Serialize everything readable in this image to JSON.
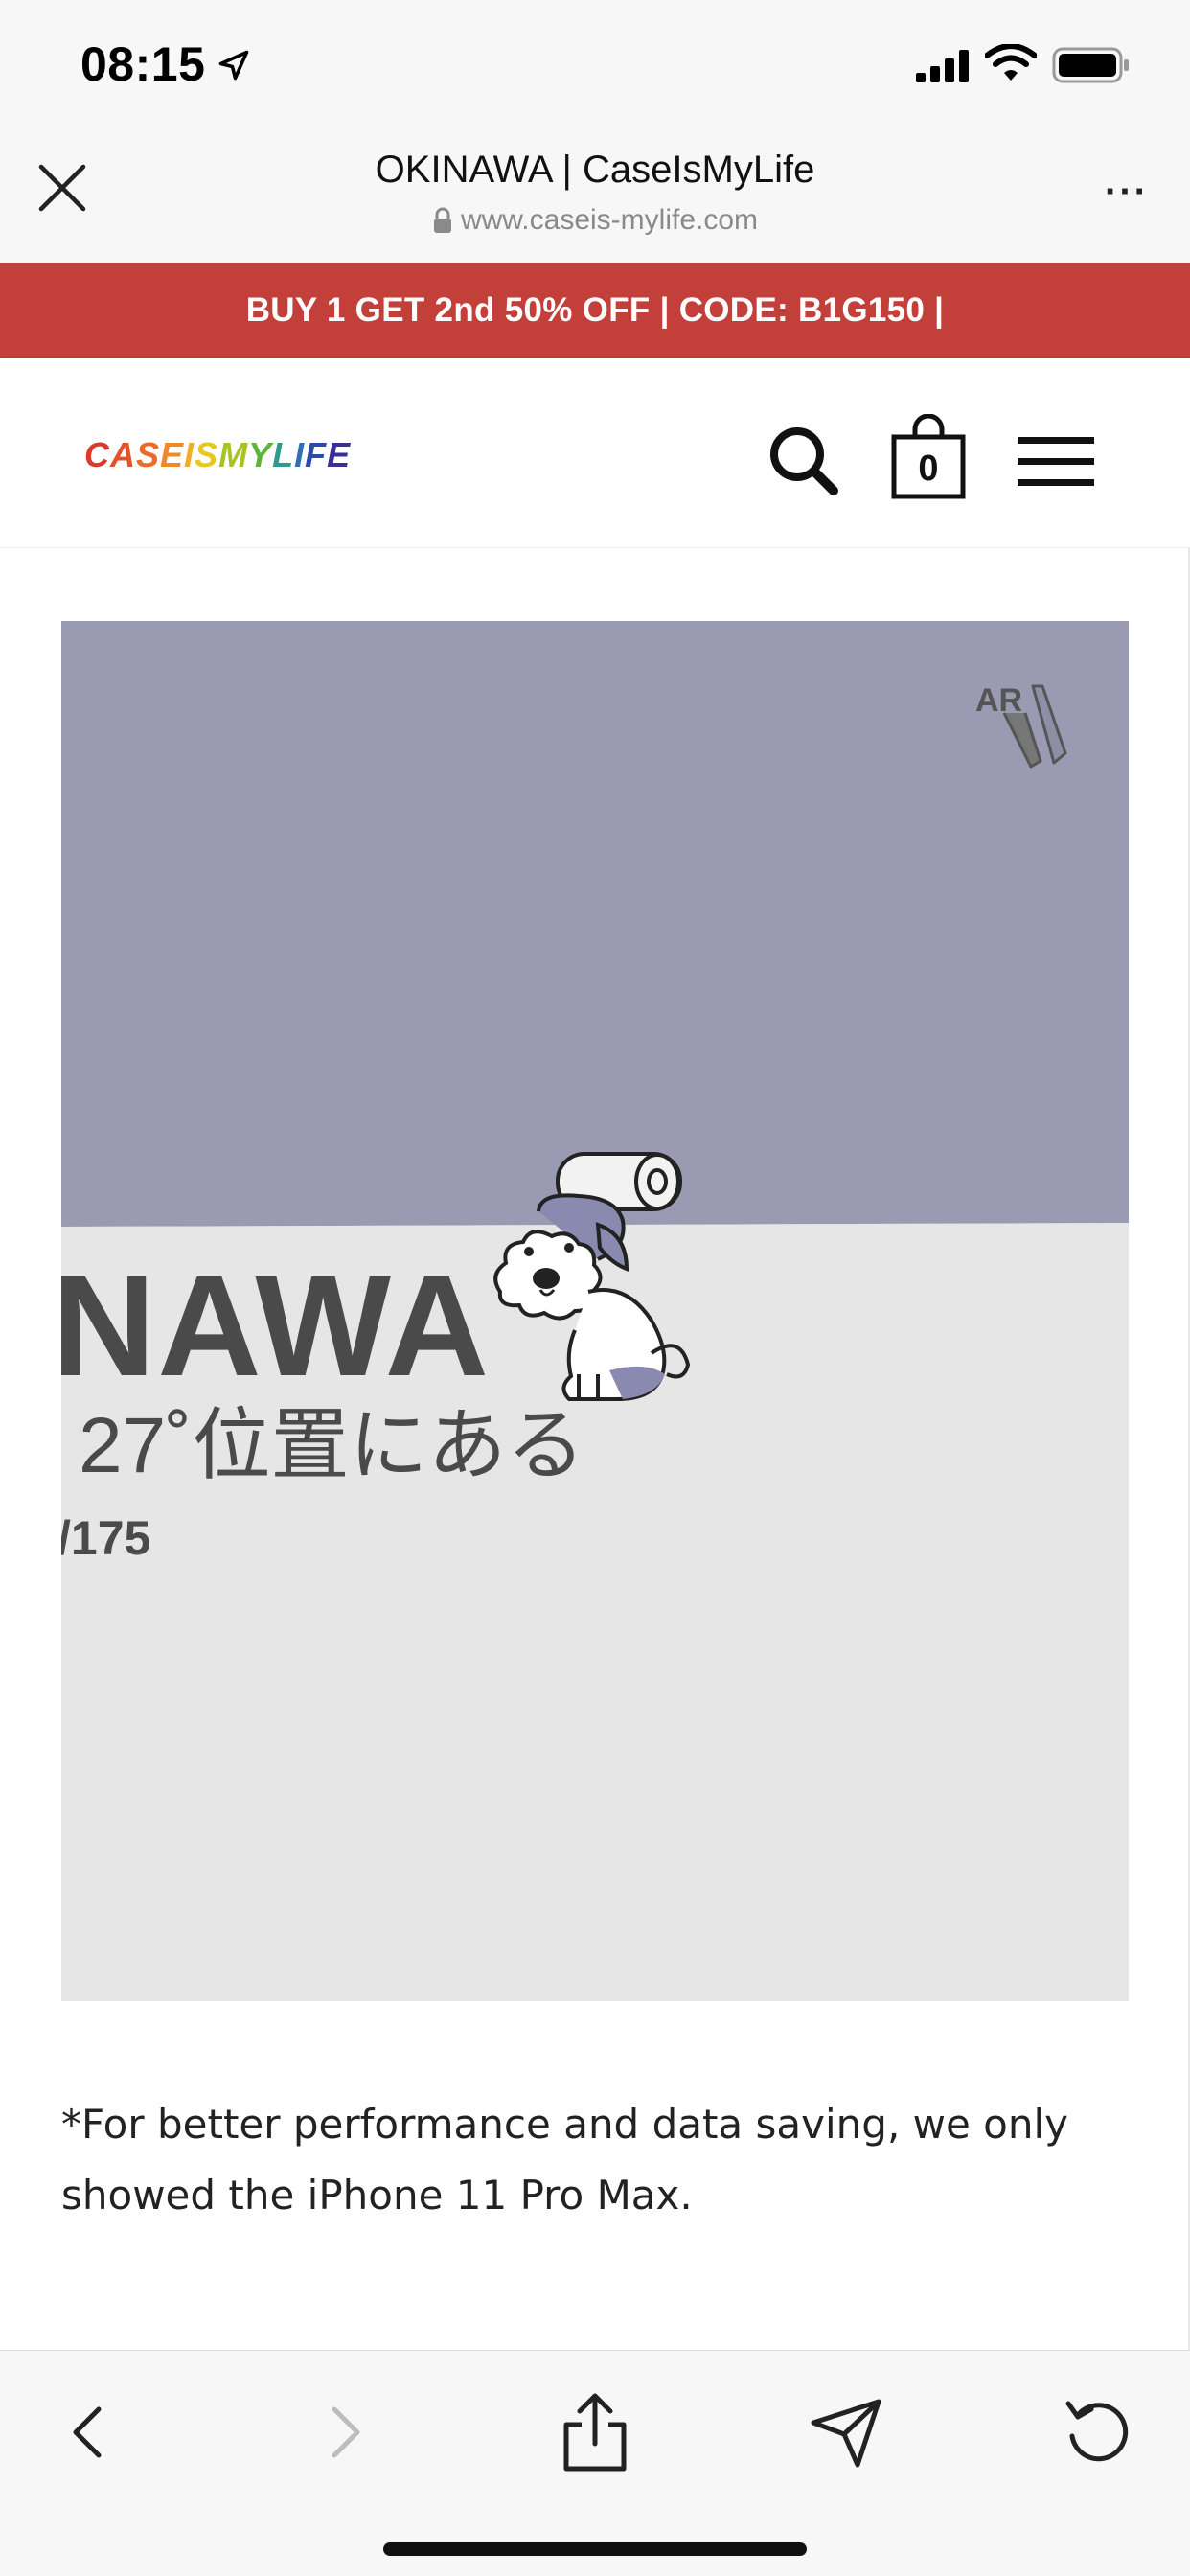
{
  "status_bar": {
    "time": "08:15",
    "icons": [
      "location-arrow-icon",
      "signal-icon",
      "wifi-icon",
      "battery-icon"
    ]
  },
  "browser": {
    "title": "OKINAWA | CaseIsMyLife",
    "url": "www.caseis-mylife.com",
    "close_icon": "close-icon",
    "more_label": "···"
  },
  "promo": {
    "text": "BUY 1 GET 2nd 50% OFF | CODE: B1G150 |"
  },
  "site_header": {
    "logo_letters": [
      "C",
      "A",
      "S",
      "E",
      "I",
      "S",
      "M",
      "Y",
      "L",
      "I",
      "F",
      "E"
    ],
    "logo_colors": [
      "#d93a2b",
      "#e5522a",
      "#ec6b2b",
      "#f08a26",
      "#f2ad22",
      "#e6c81e",
      "#a8c424",
      "#5cb53a",
      "#2e9c8c",
      "#2e6fb5",
      "#2b4aa8",
      "#3a2f96"
    ],
    "cart_count": "0"
  },
  "product_image": {
    "ar_label": "AR",
    "title_fragment": "NAWA",
    "latitude_text": "27˚位置にある",
    "code_text": "/175",
    "top_color": "#9a9ab3",
    "bottom_color": "#e6e6e6"
  },
  "note": "*For better performance and data saving, we only showed the iPhone 11 Pro Max.",
  "toolbar": {
    "items": [
      "back-icon",
      "forward-icon",
      "share-icon",
      "send-icon",
      "reload-icon"
    ]
  }
}
